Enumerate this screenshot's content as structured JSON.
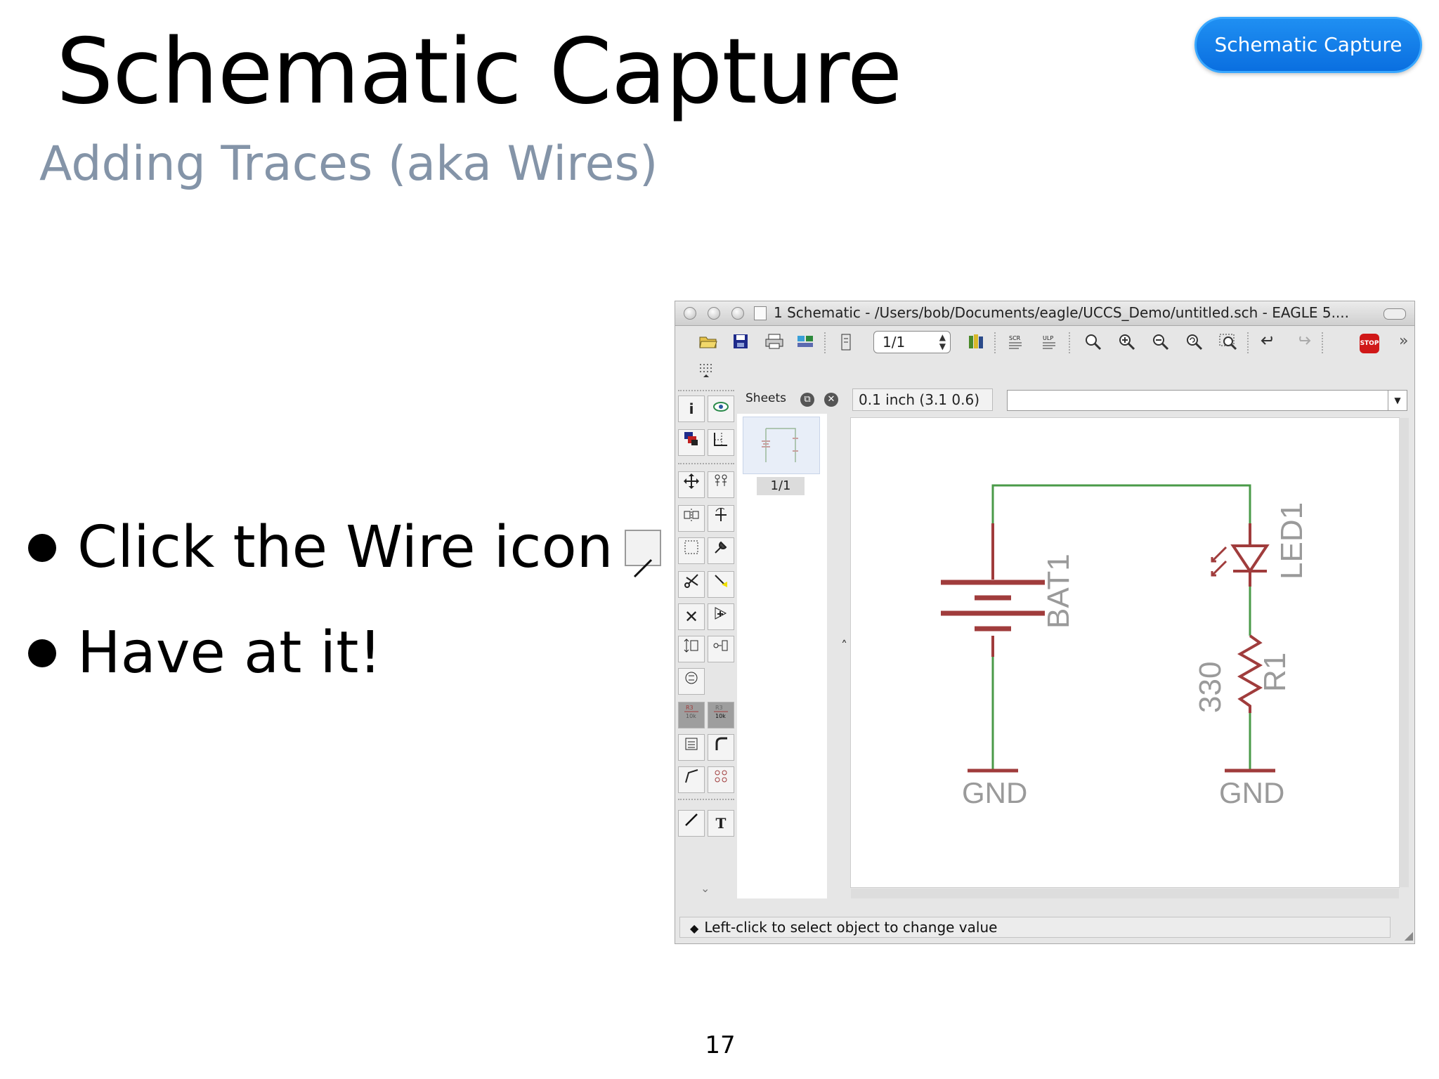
{
  "slide": {
    "title": "Schematic Capture",
    "subtitle": "Adding Traces (aka Wires)",
    "badge": "Schematic Capture",
    "bullets": [
      "Click the Wire icon",
      "Have at it!"
    ],
    "page_number": "17"
  },
  "window": {
    "title": "1 Schematic - /Users/bob/Documents/eagle/UCCS_Demo/untitled.sch - EAGLE 5....",
    "sheet_select": "1/1",
    "stop_label": "STOP",
    "sheets_label": "Sheets",
    "sheet_item": "1/1",
    "coords": "0.1 inch (3.1 0.6)",
    "command_value": "",
    "status": "Left-click to select object to change value"
  },
  "schematic": {
    "labels": {
      "bat": "BAT1",
      "led": "LED1",
      "resistor_value": "330",
      "resistor_name": "R1",
      "gnd_left": "GND",
      "gnd_right": "GND"
    },
    "colors": {
      "wire": "#4a9a48",
      "part": "#a03c3c",
      "label": "#9a9a9a"
    }
  },
  "colors": {
    "subtitle": "#8494a8",
    "badge": "#1a86ee"
  }
}
